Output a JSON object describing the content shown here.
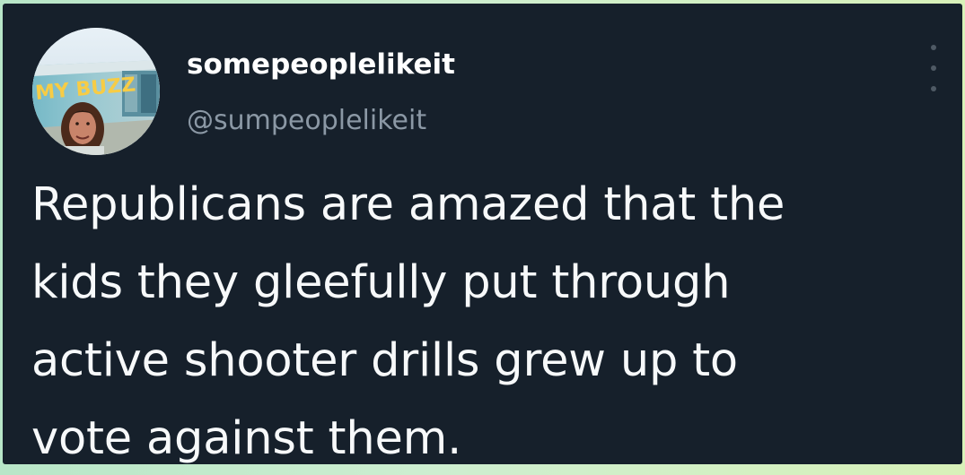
{
  "tweet": {
    "display_name": "somepeoplelikeit",
    "handle": "@sumpeoplelikeit",
    "text_lines": [
      "Republicans are amazed that the",
      "kids they gleefully put through",
      "active shooter drills grew up to",
      "vote against them."
    ],
    "avatar_sign_text": "MY BUZZ",
    "menu_icon": "more-vertical-icon"
  },
  "colors": {
    "card_background": "#16202b",
    "name": "#ffffff",
    "handle": "#8b98a5",
    "text": "#f7f9fa",
    "menu_dots": "#4f5a65",
    "outer_background": "#cdeed0"
  }
}
